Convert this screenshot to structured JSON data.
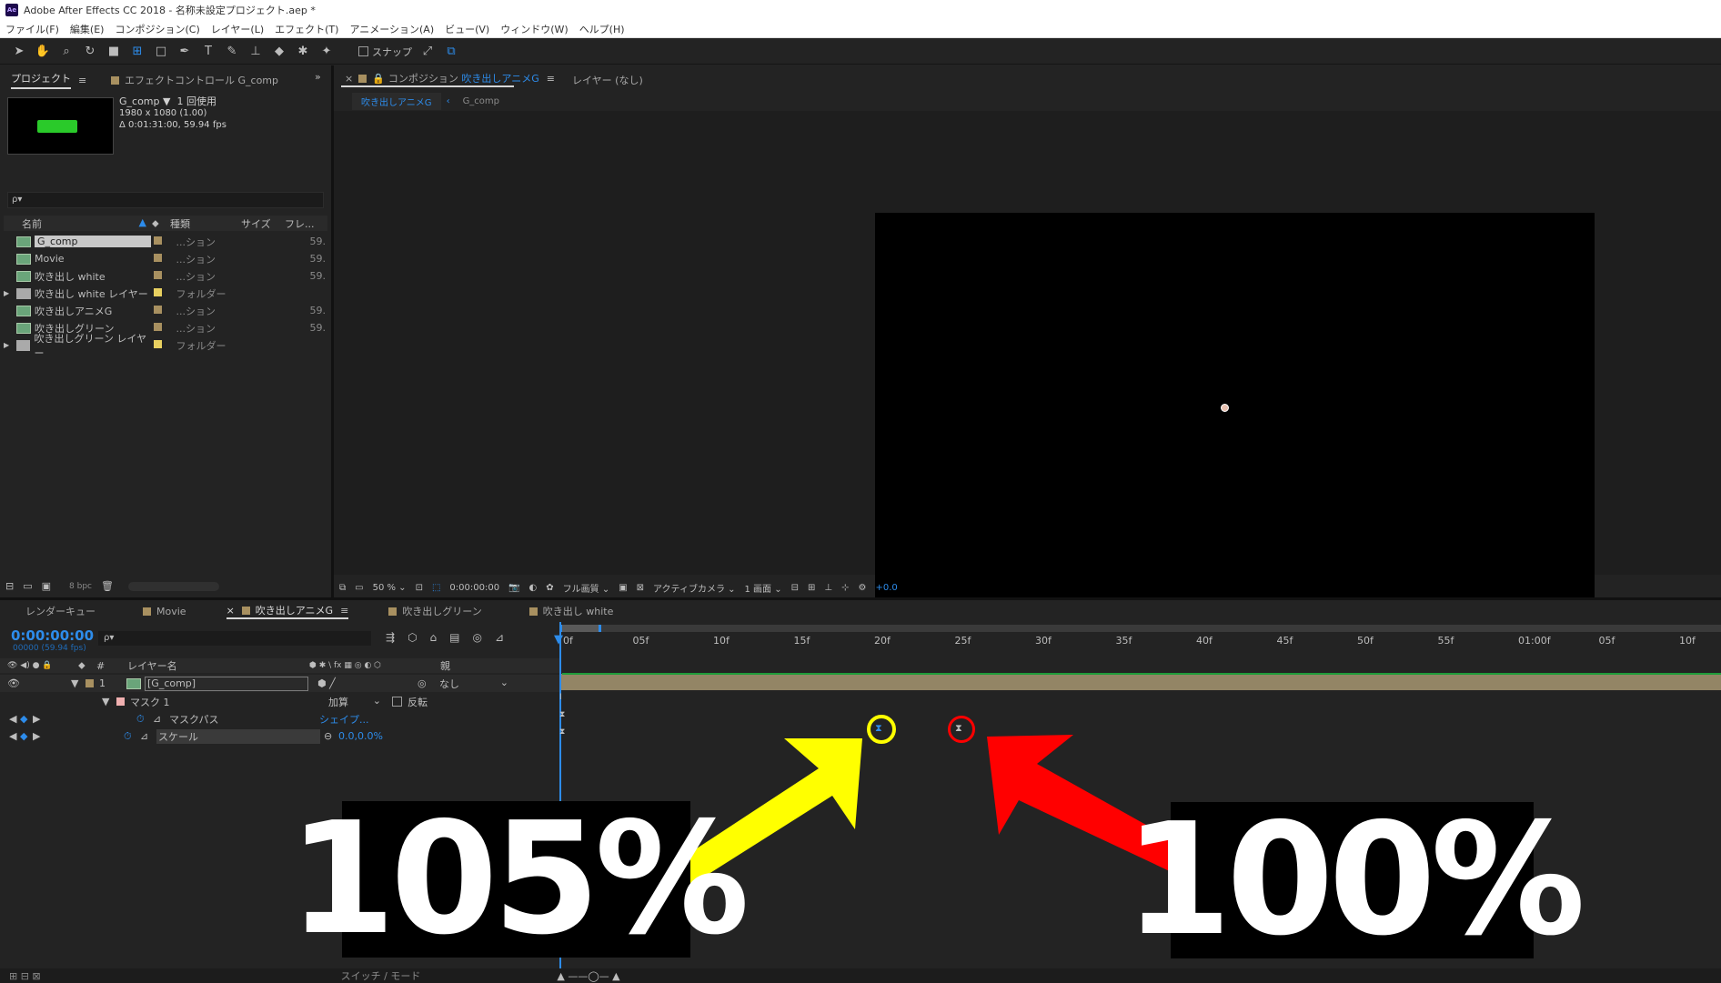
{
  "window": {
    "title": "Adobe After Effects CC 2018 - 名称未設定プロジェクト.aep *",
    "app_icon": "Ae"
  },
  "menu": [
    "ファイル(F)",
    "編集(E)",
    "コンポジション(C)",
    "レイヤー(L)",
    "エフェクト(T)",
    "アニメーション(A)",
    "ビュー(V)",
    "ウィンドウ(W)",
    "ヘルプ(H)"
  ],
  "toolbar": {
    "snap_label": "スナップ"
  },
  "project_panel": {
    "tab_label": "プロジェクト",
    "effect_tab_label": "エフェクトコントロール G_comp",
    "preview": {
      "name": "G_comp ▼",
      "usage": "1 回使用",
      "size": "1980 x 1080 (1.00)",
      "duration": "Δ 0:01:31:00, 59.94 fps"
    },
    "search_placeholder": "ρ▾",
    "columns": [
      "名前",
      "種類",
      "サイズ",
      "フレ..."
    ],
    "items": [
      {
        "name": "G_comp",
        "type": "...ション",
        "fr": "59.",
        "kind": "comp",
        "selected": true
      },
      {
        "name": "Movie",
        "type": "...ション",
        "fr": "59.",
        "kind": "comp"
      },
      {
        "name": "吹き出し white",
        "type": "...ション",
        "fr": "59.",
        "kind": "comp"
      },
      {
        "name": "吹き出し white レイヤー",
        "type": "フォルダー",
        "fr": "",
        "kind": "folder"
      },
      {
        "name": "吹き出しアニメG",
        "type": "...ション",
        "fr": "59.",
        "kind": "comp"
      },
      {
        "name": "吹き出しグリーン",
        "type": "...ション",
        "fr": "59.",
        "kind": "comp"
      },
      {
        "name": "吹き出しグリーン レイヤー",
        "type": "フォルダー",
        "fr": "",
        "kind": "folder"
      }
    ],
    "bpc": "8 bpc"
  },
  "comp_panel": {
    "tab_prefix": "コンポジション",
    "tab_comp": "吹き出しアニメG",
    "layer_tab": "レイヤー (なし)",
    "breadcrumb": [
      "吹き出しアニメG",
      "G_comp"
    ],
    "zoom": "50 %",
    "timecode": "0:00:00:00",
    "quality": "フル画質",
    "camera": "アクティブカメラ",
    "views": "1 画面",
    "exposure": "+0.0"
  },
  "timeline": {
    "tabs": [
      "レンダーキュー",
      "Movie",
      "吹き出しアニメG",
      "吹き出しグリーン",
      "吹き出し white"
    ],
    "timecode": "0:00:00:00",
    "fps": "00000 (59.94 fps)",
    "search_placeholder": "ρ▾",
    "col_layer_name": "レイヤー名",
    "col_parent": "親",
    "ruler": [
      "0f",
      "05f",
      "10f",
      "15f",
      "20f",
      "25f",
      "30f",
      "35f",
      "40f",
      "45f",
      "50f",
      "55f",
      "01:00f",
      "05f",
      "10f"
    ],
    "layer": {
      "index": "1",
      "name": "[G_comp]",
      "parent": "なし"
    },
    "mask": {
      "name": "マスク 1",
      "mode": "加算",
      "invert": "反転"
    },
    "mask_path": {
      "name": "マスクパス",
      "value": "シェイプ..."
    },
    "scale": {
      "name": "スケール",
      "value": "0.0,0.0%"
    },
    "switch_mode": "スイッチ / モード"
  },
  "annotations": {
    "left_label": "105%",
    "right_label": "100%",
    "left_color": "#ffff00",
    "right_color": "#ff0000"
  }
}
